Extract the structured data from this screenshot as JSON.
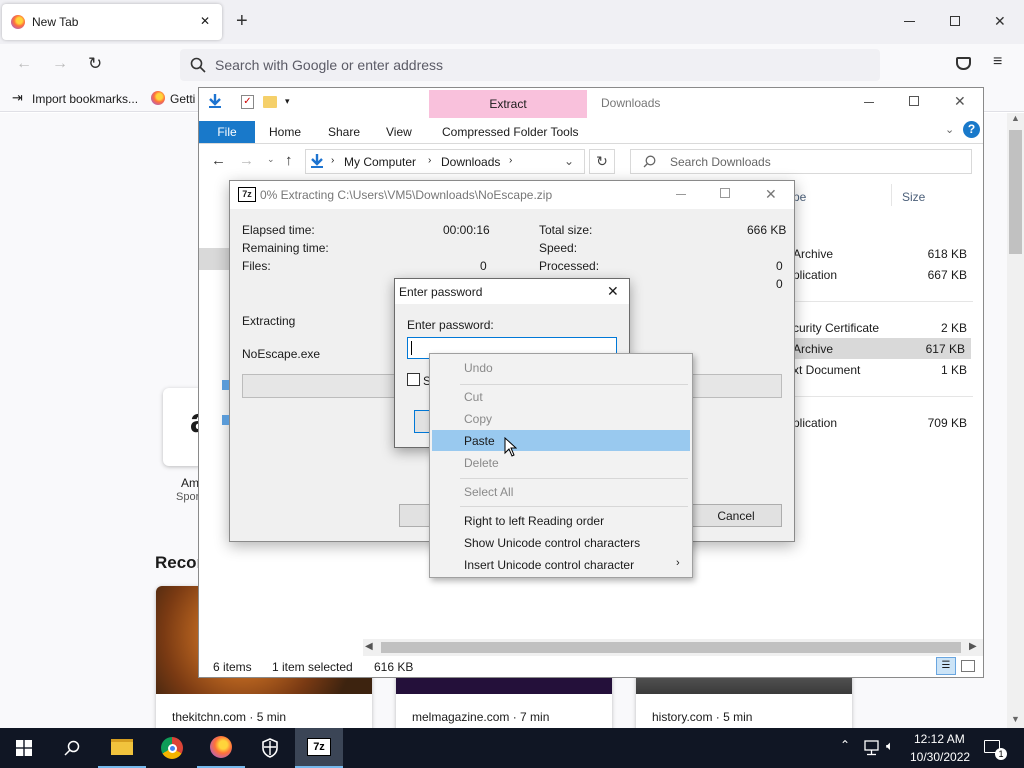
{
  "firefox": {
    "tab_title": "New Tab",
    "tab_close": "✕",
    "new_tab": "+",
    "url_placeholder": "Search with Google or enter address",
    "bookmarks": [
      "Import bookmarks...",
      "Getti"
    ],
    "shortcut_letter": "a",
    "shortcut_label": "Am",
    "shortcut_sub": "Spor",
    "recent_heading": "Recor",
    "cards": [
      {
        "source": "thekitchn.com · 5 min"
      },
      {
        "source": "melmagazine.com · 7 min"
      },
      {
        "source": "history.com · 5 min"
      }
    ]
  },
  "explorer": {
    "window_title": "Downloads",
    "extract_tab": "Extract",
    "ribbon_tabs": [
      "File",
      "Home",
      "Share",
      "View",
      "Compressed Folder Tools"
    ],
    "breadcrumb": [
      "My Computer",
      "Downloads"
    ],
    "search_placeholder": "Search Downloads",
    "col_type": "pe",
    "col_size": "Size",
    "rows": [
      {
        "type": "Archive",
        "size": "618 KB"
      },
      {
        "type": "plication",
        "size": "667 KB"
      },
      {
        "type": "curity Certificate",
        "size": "2 KB"
      },
      {
        "type": "Archive",
        "size": "617 KB"
      },
      {
        "type": "xt Document",
        "size": "1 KB"
      },
      {
        "type": "plication",
        "size": "709 KB"
      }
    ],
    "status_items": "6 items",
    "status_selected": "1 item selected",
    "status_size": "616 KB"
  },
  "sevenzip": {
    "app_icon": "7z",
    "title": "0% Extracting C:\\Users\\VM5\\Downloads\\NoEscape.zip",
    "elapsed_label": "Elapsed time:",
    "elapsed_value": "00:00:16",
    "remaining_label": "Remaining time:",
    "files_label": "Files:",
    "files_value": "0",
    "total_label": "Total size:",
    "total_value": "666 KB",
    "speed_label": "Speed:",
    "processed_label": "Processed:",
    "processed_value": "0",
    "extra_value": "0",
    "extracting_label": "Extracting",
    "file_name": "NoEscape.exe",
    "cancel": "Cancel"
  },
  "password": {
    "title": "Enter password",
    "label": "Enter password:",
    "checkbox_label": "S"
  },
  "context_menu": [
    {
      "label": "Undo",
      "disabled": true
    },
    {
      "label": "Cut",
      "disabled": true
    },
    {
      "label": "Copy",
      "disabled": true
    },
    {
      "label": "Paste",
      "disabled": false
    },
    {
      "label": "Delete",
      "disabled": true
    },
    {
      "label": "Select All",
      "disabled": true
    },
    {
      "label": "Right to left Reading order",
      "disabled": false
    },
    {
      "label": "Show Unicode control characters",
      "disabled": false
    },
    {
      "label": "Insert Unicode control character",
      "disabled": false
    }
  ],
  "taskbar": {
    "seven_zip_label": "7z",
    "time": "12:12 AM",
    "date": "10/30/2022",
    "notification_count": "1"
  },
  "colors": {
    "accent": "#0063b1",
    "menu_highlight": "#99c9ef",
    "extract_tab": "#f9c1dc",
    "taskbar": "#101624"
  }
}
